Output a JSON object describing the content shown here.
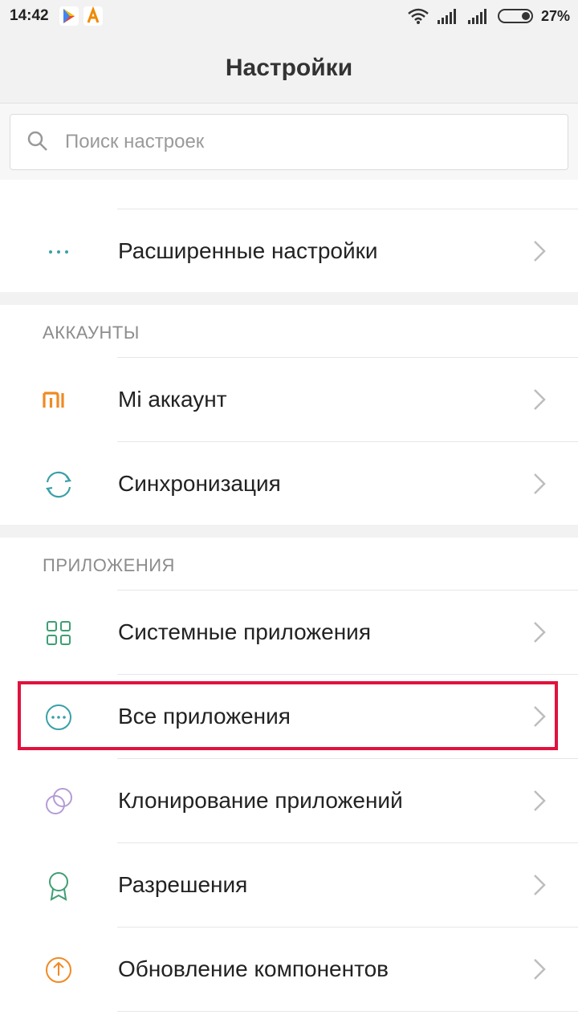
{
  "status_bar": {
    "time": "14:42",
    "battery_percent": "27%",
    "battery_level": 0.27,
    "apps": [
      "google-play-icon",
      "app-a-icon"
    ]
  },
  "header": {
    "title": "Настройки"
  },
  "search": {
    "placeholder": "Поиск настроек",
    "value": ""
  },
  "top_group": {
    "items": [
      {
        "label": "Расширенные настройки",
        "icon": "more-dots-icon"
      }
    ]
  },
  "accounts": {
    "header": "АККАУНТЫ",
    "items": [
      {
        "label": "Mi аккаунт",
        "icon": "mi-logo-icon"
      },
      {
        "label": "Синхронизация",
        "icon": "sync-icon"
      }
    ]
  },
  "apps_section": {
    "header": "ПРИЛОЖЕНИЯ",
    "items": [
      {
        "label": "Системные приложения",
        "icon": "grid-icon"
      },
      {
        "label": "Все приложения",
        "icon": "more-circle-icon"
      },
      {
        "label": "Клонирование приложений",
        "icon": "clone-circles-icon"
      },
      {
        "label": "Разрешения",
        "icon": "badge-icon"
      },
      {
        "label": "Обновление компонентов",
        "icon": "upload-icon"
      }
    ]
  },
  "colors": {
    "highlight": "#e0123e",
    "icon_teal": "#3aa0a8",
    "icon_orange": "#f08a24",
    "icon_purple": "#b59bd6",
    "icon_green": "#3e9e74"
  }
}
